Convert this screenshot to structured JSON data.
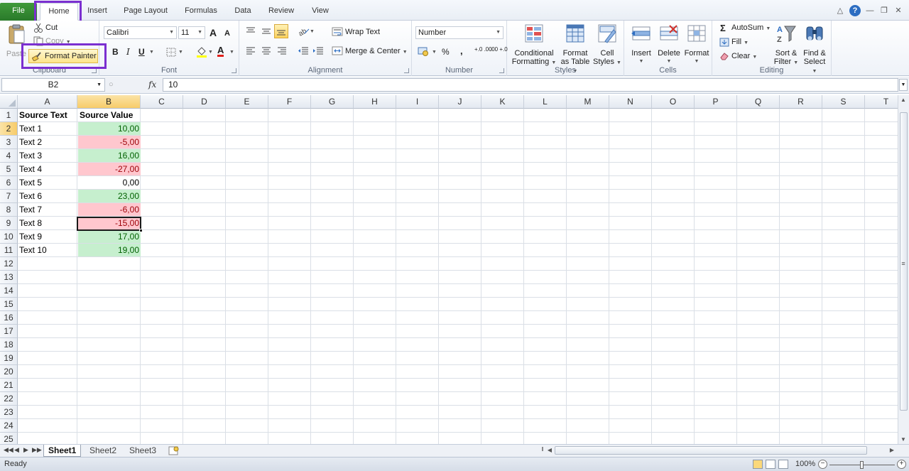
{
  "tabs": {
    "file": "File",
    "home": "Home",
    "insert": "Insert",
    "page_layout": "Page Layout",
    "formulas": "Formulas",
    "data": "Data",
    "review": "Review",
    "view": "View"
  },
  "window_controls": {
    "help": "?"
  },
  "ribbon": {
    "clipboard": {
      "label": "Clipboard",
      "paste": "Paste",
      "cut": "Cut",
      "copy": "Copy",
      "format_painter": "Format Painter"
    },
    "font": {
      "label": "Font",
      "font_name": "Calibri",
      "font_size": "11",
      "grow": "A",
      "shrink": "A",
      "bold": "B",
      "italic": "I",
      "underline": "U",
      "font_color_letter": "A"
    },
    "alignment": {
      "label": "Alignment",
      "wrap_text": "Wrap Text",
      "merge_center": "Merge & Center"
    },
    "number": {
      "label": "Number",
      "format": "Number",
      "percent": "%",
      "comma": ",",
      "inc_decimal": "+.0 .00",
      "dec_decimal": ".00 +.0"
    },
    "styles": {
      "label": "Styles",
      "conditional_formatting_1": "Conditional",
      "conditional_formatting_2": "Formatting",
      "format_table_1": "Format",
      "format_table_2": "as Table",
      "cell_styles_1": "Cell",
      "cell_styles_2": "Styles"
    },
    "cells": {
      "label": "Cells",
      "insert": "Insert",
      "delete": "Delete",
      "format": "Format"
    },
    "editing": {
      "label": "Editing",
      "autosum": "AutoSum",
      "fill": "Fill",
      "clear": "Clear",
      "sort_filter_1": "Sort &",
      "sort_filter_2": "Filter",
      "find_select_1": "Find &",
      "find_select_2": "Select"
    }
  },
  "formula_bar": {
    "name_box": "B2",
    "fx": "fx",
    "value": "10"
  },
  "columns": [
    "A",
    "B",
    "C",
    "D",
    "E",
    "F",
    "G",
    "H",
    "I",
    "J",
    "K",
    "L",
    "M",
    "N",
    "O",
    "P",
    "Q",
    "R",
    "S",
    "T"
  ],
  "rows": [
    "1",
    "2",
    "3",
    "4",
    "5",
    "6",
    "7",
    "8",
    "9",
    "10",
    "11",
    "12",
    "13",
    "14",
    "15",
    "16",
    "17",
    "18",
    "19",
    "20",
    "21",
    "22",
    "23",
    "24",
    "25"
  ],
  "sheet": {
    "header": {
      "a": "Source Text",
      "b": "Source Value"
    },
    "data": [
      {
        "a": "Text 1",
        "b": "10,00",
        "status": "positive"
      },
      {
        "a": "Text 2",
        "b": "-5,00",
        "status": "negative"
      },
      {
        "a": "Text 3",
        "b": "16,00",
        "status": "positive"
      },
      {
        "a": "Text 4",
        "b": "-27,00",
        "status": "negative"
      },
      {
        "a": "Text 5",
        "b": "0,00",
        "status": "neutral"
      },
      {
        "a": "Text 6",
        "b": "23,00",
        "status": "positive"
      },
      {
        "a": "Text 7",
        "b": "-6,00",
        "status": "negative"
      },
      {
        "a": "Text 8",
        "b": "-15,00",
        "status": "negative"
      },
      {
        "a": "Text 9",
        "b": "17,00",
        "status": "positive"
      },
      {
        "a": "Text 10",
        "b": "19,00",
        "status": "positive"
      }
    ]
  },
  "colors": {
    "positive_fill": "#c6efce",
    "positive_text": "#006100",
    "negative_fill": "#ffc7ce",
    "negative_text": "#9c0006",
    "highlight_box": "#7b2fd0",
    "file_tab": "#2a7a2a"
  },
  "sheet_tabs": [
    "Sheet1",
    "Sheet2",
    "Sheet3"
  ],
  "active_sheet": "Sheet1",
  "status": {
    "text": "Ready",
    "zoom": "100%"
  },
  "icons": {
    "paste": "clipboard-icon",
    "cut": "scissors-icon",
    "copy": "copy-icon",
    "format_painter": "paintbrush-icon",
    "autosum": "sigma-icon",
    "fill": "fill-down-icon",
    "clear": "eraser-icon",
    "sort": "sort-filter-icon",
    "find": "binoculars-icon"
  }
}
